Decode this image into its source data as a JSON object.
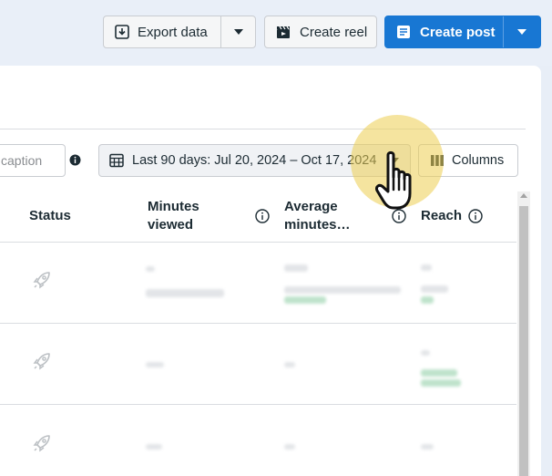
{
  "toolbar": {
    "export_label": "Export data",
    "create_reel_label": "Create reel",
    "create_post_label": "Create post"
  },
  "filters": {
    "search_placeholder": "caption",
    "date_range_label": "Last 90 days: Jul 20, 2024 – Oct 17, 2024",
    "columns_label": "Columns"
  },
  "table": {
    "headers": {
      "status": "Status",
      "minutes_viewed": "Minutes viewed",
      "average_minutes": "Average minutes…",
      "reach": "Reach"
    }
  },
  "colors": {
    "primary": "#1877d3",
    "highlight": "#ecd050",
    "text": "#1c2b33"
  },
  "icons": [
    "export-icon",
    "chevron-down-icon",
    "clapperboard-icon",
    "post-icon",
    "info-icon",
    "calendar-icon",
    "columns-icon",
    "rocket-icon",
    "hand-pointer-icon"
  ]
}
